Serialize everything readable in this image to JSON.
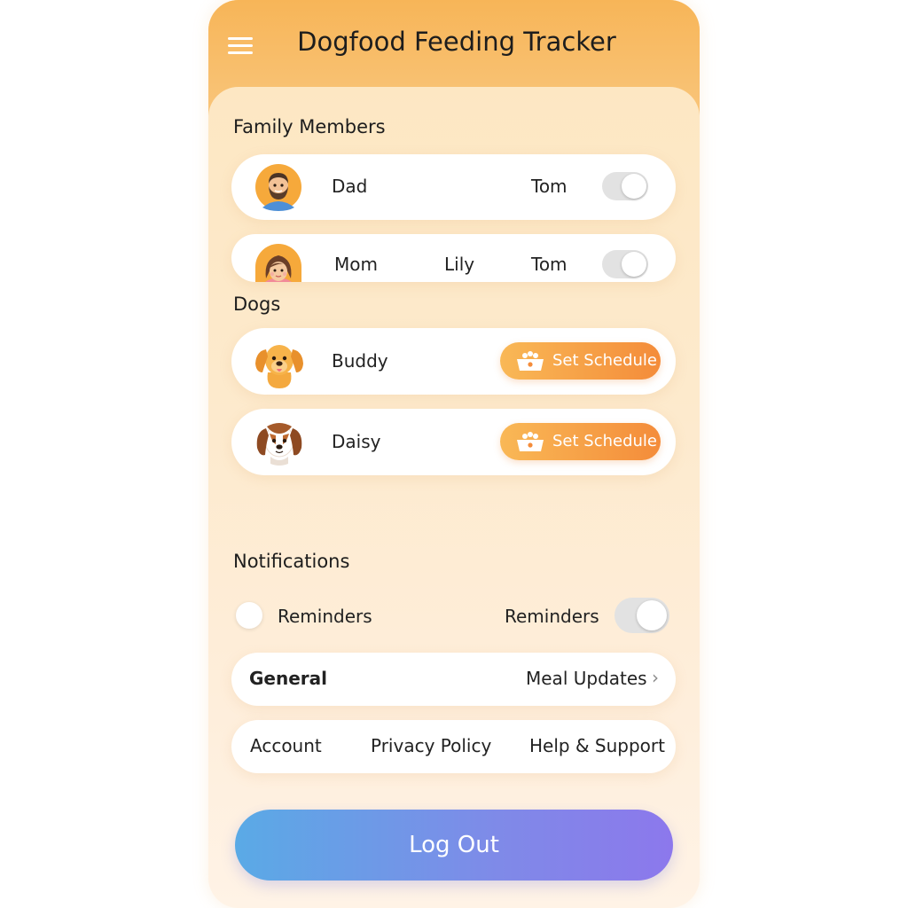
{
  "app": {
    "title": "Dogfood Feeding Tracker"
  },
  "sections": {
    "family": "Family Members",
    "dogs": "Dogs",
    "notifications": "Notifications"
  },
  "family_members": [
    {
      "name": "Dad",
      "assignee": "Tom",
      "toggle_on": false
    },
    {
      "name": "Mom",
      "other": "Lily",
      "assignee": "Tom",
      "toggle_on": false
    }
  ],
  "dogs": [
    {
      "name": "Buddy",
      "action": "Set Schedule"
    },
    {
      "name": "Daisy",
      "action": "Set Schedule"
    }
  ],
  "notifications": {
    "left_label": "Reminders",
    "right_label": "Reminders",
    "toggle_on": false
  },
  "general": {
    "label": "General",
    "value": "Meal Updates"
  },
  "links": {
    "account": "Account",
    "privacy": "Privacy Policy",
    "help": "Help & Support"
  },
  "logout_label": "Log Out",
  "icons": [
    "menu-icon",
    "dad-avatar-icon",
    "mom-avatar-icon",
    "buddy-dog-icon",
    "daisy-dog-icon",
    "food-bowl-icon",
    "chevron-right-icon"
  ],
  "colors": {
    "header": "#f7b558",
    "accent_orange": "#f48c3a",
    "logout_start": "#5aaae6",
    "logout_end": "#8c78ec"
  }
}
